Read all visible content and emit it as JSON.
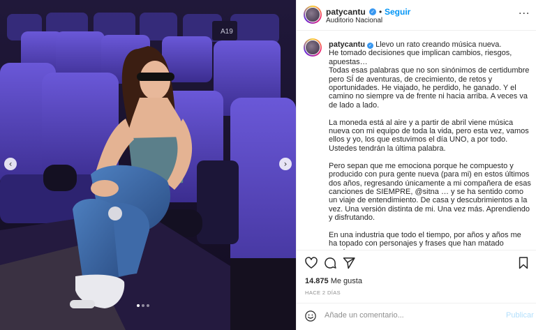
{
  "header": {
    "username": "patycantu",
    "verified": true,
    "separator": "•",
    "follow_label": "Seguir",
    "location": "Auditorio Nacional",
    "more_icon": "more-options-icon"
  },
  "media": {
    "prev_glyph": "‹",
    "next_glyph": "›",
    "row_label": "A19",
    "carousel": {
      "total": 3,
      "active_index": 0
    }
  },
  "caption": {
    "username": "patycantu",
    "text": "Llevo un rato creando música nueva.\nHe tomado decisiones que implican cambios, riesgos, apuestas…\nTodas esas palabras que no son sinónimos de certidumbre pero SÍ de aventuras, de crecimiento, de retos y oportunidades. He viajado, he perdido, he ganado. Y el camino no siempre va de frente ni hacia arriba. A veces va de lado a lado.\n\nLa moneda está al aire y a partir de abril viene música nueva con mi equipo de toda la vida, pero esta vez, vamos ellos y yo, los que estuvimos el día UNO, a por todo.\nUstedes tendrán la última palabra.\n\nPero sepan que me emociona porque he compuesto y producido con pura gente nueva (para mi) en estos últimos dos años, regresando únicamente a mi compañera de esas canciones de SIEMPRE, @sitna … y se ha sentido como un viaje de entendimiento. De casa y descubrimientos a la vez. Una versión distinta de mi. Una vez más. Aprendiendo y disfrutando.\n\nEn una industria que todo el tiempo, por años y años me ha topado con personajes y frases que han matado muchas"
  },
  "actions": {
    "like_icon": "heart-icon",
    "comment_icon": "comment-icon",
    "share_icon": "share-icon",
    "save_icon": "bookmark-icon",
    "likes_count": "14.875",
    "likes_suffix": " Me gusta",
    "time_ago": "HACE 2 DÍAS"
  },
  "comment": {
    "emoji_icon": "emoji-icon",
    "placeholder": "Añade un comentario...",
    "publish_label": "Publicar"
  },
  "colors": {
    "accent": "#0095f6",
    "seat_purple": "#4f3fb0",
    "verified_blue": "#3897f0"
  }
}
